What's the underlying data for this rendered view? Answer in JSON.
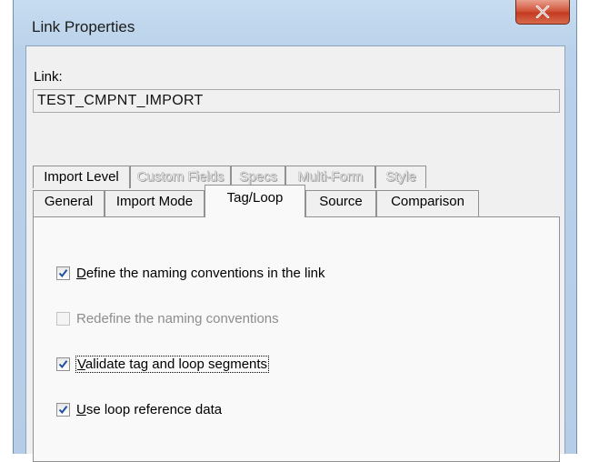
{
  "window": {
    "title": "Link Properties",
    "close_glyph": "X"
  },
  "link": {
    "label": "Link:",
    "value": "TEST_CMPNT_IMPORT"
  },
  "tabs_row1": [
    {
      "label": "Import Level",
      "enabled": true
    },
    {
      "label": "Custom Fields",
      "enabled": false
    },
    {
      "label": "Specs",
      "enabled": false
    },
    {
      "label": "Multi-Form",
      "enabled": false
    },
    {
      "label": "Style",
      "enabled": false
    }
  ],
  "tabs_row2": [
    {
      "label": "General"
    },
    {
      "label": "Import Mode"
    },
    {
      "label": "Tag/Loop",
      "active": true
    },
    {
      "label": "Source"
    },
    {
      "label": "Comparison"
    }
  ],
  "options": [
    {
      "mnemonic": "D",
      "rest": "efine the naming conventions in the link",
      "checked": true,
      "enabled": true
    },
    {
      "mnemonic": "",
      "rest": "Redefine the naming conventions",
      "checked": false,
      "enabled": false
    },
    {
      "mnemonic": "V",
      "rest": "alidate tag and loop segments",
      "checked": true,
      "enabled": true,
      "focused": true
    },
    {
      "mnemonic": "U",
      "rest": "se loop reference data",
      "checked": true,
      "enabled": true
    }
  ],
  "icons": {
    "close": "close-icon",
    "check": "checkmark-icon"
  },
  "colors": {
    "close_button": "#c94a30",
    "check": "#1f4fa0",
    "frame": "#b9d1ea"
  }
}
